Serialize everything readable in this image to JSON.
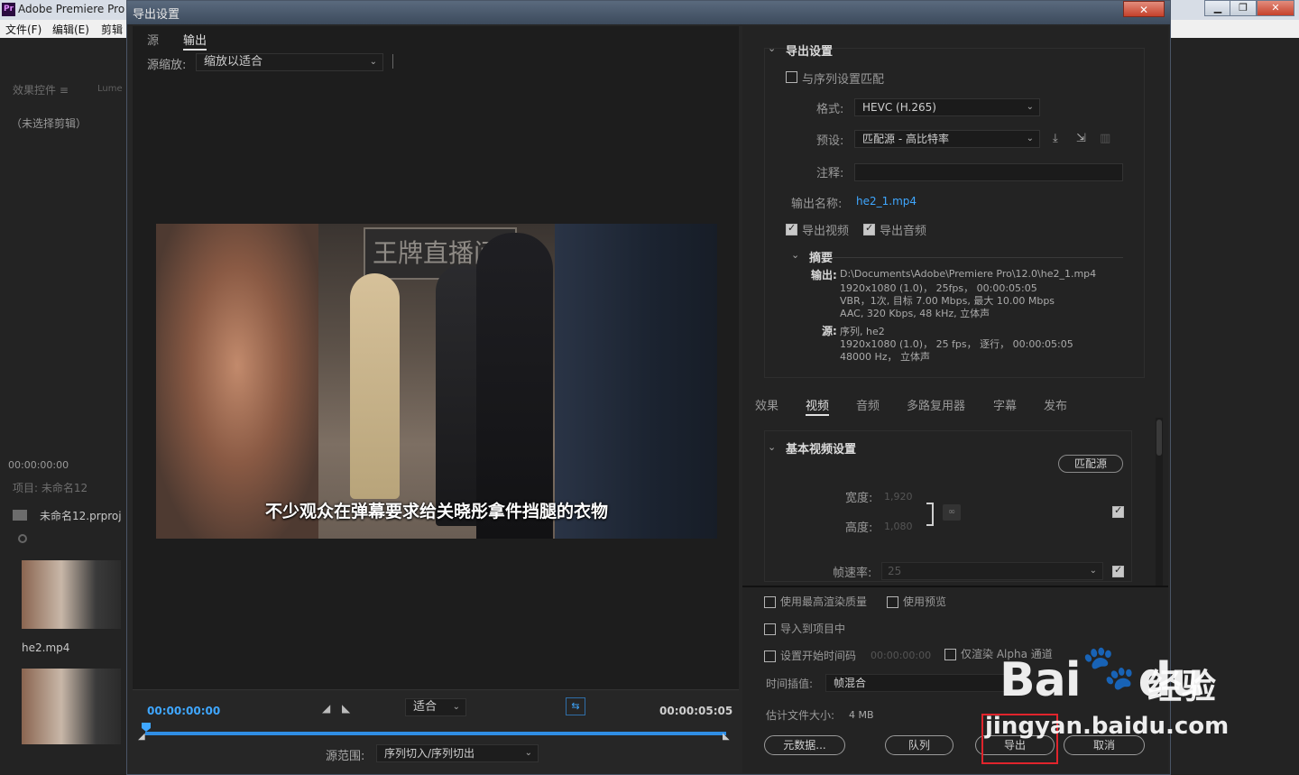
{
  "app": {
    "title": "Adobe Premiere Pro",
    "logo": "Pr",
    "menu": [
      "文件(F)",
      "编辑(E)",
      "剪辑"
    ],
    "window_controls": [
      "minimize-icon",
      "maximize-icon",
      "close-icon"
    ],
    "effects_tab": "效果控件 ≡",
    "lumetri_tab": "Lume",
    "no_clip": "（未选择剪辑）",
    "timecode": "00:00:00:00",
    "project_title": "项目: 未命名12",
    "project_file": "未命名12.prproj",
    "clip_name": "he2.mp4"
  },
  "dialog": {
    "title": "导出设置",
    "close": "✕",
    "tabs": {
      "source": "源",
      "output": "输出"
    },
    "source_scale_label": "源缩放:",
    "source_scale_value": "缩放以适合",
    "video": {
      "sign_text": "王牌直播间",
      "subtitle": "不少观众在弹幕要求给关晓彤拿件挡腿的衣物"
    },
    "timeline": {
      "tc_start": "00:00:00:00",
      "tc_end": "00:00:05:05",
      "fit_value": "适合",
      "source_range_label": "源范围:",
      "source_range_value": "序列切入/序列切出"
    },
    "export_settings": {
      "section_title": "导出设置",
      "match_sequence": "与序列设置匹配",
      "format_label": "格式:",
      "format_value": "HEVC (H.265)",
      "preset_label": "预设:",
      "preset_value": "匹配源 - 高比特率",
      "comment_label": "注释:",
      "output_name_label": "输出名称:",
      "output_name_value": "he2_1.mp4",
      "export_video": "导出视频",
      "export_audio": "导出音频",
      "summary_title": "摘要",
      "output_label": "输出:",
      "output_lines": [
        "D:\\Documents\\Adobe\\Premiere Pro\\12.0\\he2_1.mp4",
        "1920x1080 (1.0)， 25fps， 00:00:05:05",
        "VBR，1次, 目标 7.00 Mbps, 最大 10.00 Mbps",
        "AAC, 320 Kbps, 48 kHz, 立体声"
      ],
      "source_label": "源:",
      "source_lines": [
        "序列, he2",
        "1920x1080 (1.0)， 25 fps， 逐行， 00:00:05:05",
        "48000 Hz， 立体声"
      ]
    },
    "settings_tabs": [
      "效果",
      "视频",
      "音频",
      "多路复用器",
      "字幕",
      "发布"
    ],
    "basic_video": {
      "title": "基本视频设置",
      "match_source": "匹配源",
      "width_label": "宽度:",
      "width_value": "1,920",
      "height_label": "高度:",
      "height_value": "1,080",
      "framerate_label": "帧速率:",
      "framerate_value": "25"
    },
    "bottom": {
      "max_render_quality": "使用最高渲染质量",
      "use_previews": "使用预览",
      "import_into_project": "导入到项目中",
      "set_start_timecode": "设置开始时间码",
      "start_timecode_value": "00:00:00:00",
      "render_alpha_only": "仅渲染 Alpha 通道",
      "time_interp_label": "时间插值:",
      "time_interp_value": "帧混合",
      "est_size_label": "估计文件大小:",
      "est_size_value": "4 MB",
      "metadata_btn": "元数据...",
      "queue_btn": "队列",
      "export_btn": "导出",
      "cancel_btn": "取消"
    }
  },
  "watermark": {
    "brand": "Bai",
    "brand_tail": "du",
    "cn": "经验",
    "url": "jingyan.baidu.com"
  },
  "colors": {
    "accent": "#3fa7ff",
    "highlight": "#e0242c"
  }
}
